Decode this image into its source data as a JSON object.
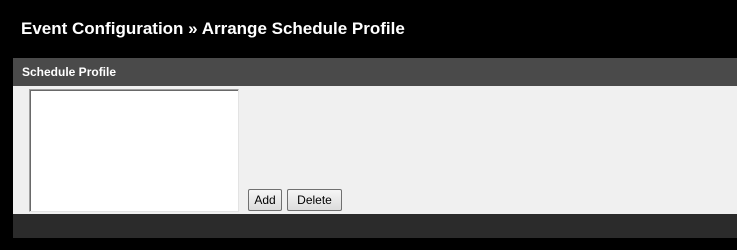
{
  "header": {
    "title": "Event Configuration » Arrange Schedule Profile"
  },
  "schedule_panel": {
    "title": "Schedule Profile",
    "profiles": [],
    "add_label": "Add",
    "delete_label": "Delete"
  },
  "colors": {
    "page_background": "#000000",
    "panel_header": "#4a4a4a",
    "panel_body": "#f0f0f0",
    "panel_footer": "#2b2b2b"
  }
}
